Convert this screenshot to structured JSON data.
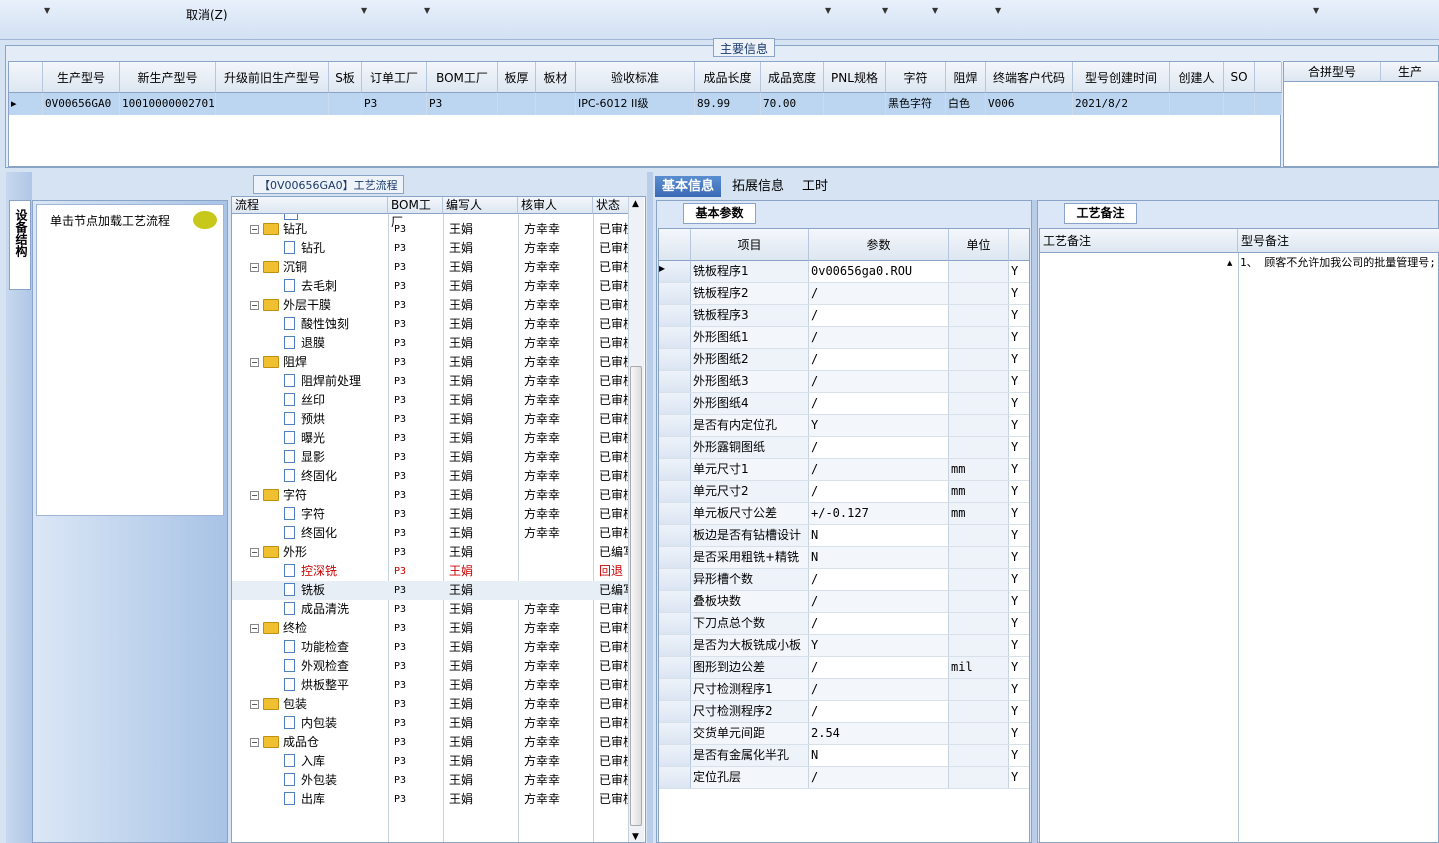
{
  "toolbar": {
    "cancel_label": "取消(Z)"
  },
  "main_info": {
    "title": "主要信息",
    "columns": [
      "生产型号",
      "新生产型号",
      "升级前旧生产型号",
      "S板",
      "订单工厂",
      "BOM工厂",
      "板厚",
      "板材",
      "验收标准",
      "成品长度",
      "成品宽度",
      "PNL规格",
      "字符",
      "阻焊",
      "终端客户代码",
      "型号创建时间",
      "创建人",
      "SO"
    ],
    "row": [
      "0V00656GA0",
      "10010000002701",
      "",
      "",
      "P3",
      "P3",
      "",
      "",
      "IPC-6012 II级",
      "89.99",
      "70.00",
      "",
      "黑色字符",
      "白色",
      "V006",
      "2021/8/2",
      "",
      ""
    ],
    "merge_columns": [
      "合拼型号",
      "生产"
    ]
  },
  "left_tab": {
    "label": "设备结构",
    "hint": "单击节点加载工艺流程"
  },
  "flow": {
    "title": "【0V00656GA0】工艺流程",
    "columns": [
      "流程",
      "BOM工厂",
      "编写人",
      "核审人",
      "状态"
    ],
    "rows": [
      {
        "level": 0,
        "name": "钻孔",
        "factory": "P3",
        "writer": "王娟",
        "reviewer": "方幸幸",
        "status": "已审核",
        "red": false
      },
      {
        "level": 1,
        "name": "钻孔",
        "factory": "P3",
        "writer": "王娟",
        "reviewer": "方幸幸",
        "status": "已审核",
        "red": false
      },
      {
        "level": 0,
        "name": "沉铜",
        "factory": "P3",
        "writer": "王娟",
        "reviewer": "方幸幸",
        "status": "已审核",
        "red": false
      },
      {
        "level": 1,
        "name": "去毛刺",
        "factory": "P3",
        "writer": "王娟",
        "reviewer": "方幸幸",
        "status": "已审核",
        "red": false
      },
      {
        "level": 0,
        "name": "外层干膜",
        "factory": "P3",
        "writer": "王娟",
        "reviewer": "方幸幸",
        "status": "已审核",
        "red": false
      },
      {
        "level": 1,
        "name": "酸性蚀刻",
        "factory": "P3",
        "writer": "王娟",
        "reviewer": "方幸幸",
        "status": "已审核",
        "red": false
      },
      {
        "level": 1,
        "name": "退膜",
        "factory": "P3",
        "writer": "王娟",
        "reviewer": "方幸幸",
        "status": "已审核",
        "red": false
      },
      {
        "level": 0,
        "name": "阻焊",
        "factory": "P3",
        "writer": "王娟",
        "reviewer": "方幸幸",
        "status": "已审核",
        "red": false
      },
      {
        "level": 1,
        "name": "阻焊前处理",
        "factory": "P3",
        "writer": "王娟",
        "reviewer": "方幸幸",
        "status": "已审核",
        "red": false
      },
      {
        "level": 1,
        "name": "丝印",
        "factory": "P3",
        "writer": "王娟",
        "reviewer": "方幸幸",
        "status": "已审核",
        "red": false
      },
      {
        "level": 1,
        "name": "预烘",
        "factory": "P3",
        "writer": "王娟",
        "reviewer": "方幸幸",
        "status": "已审核",
        "red": false
      },
      {
        "level": 1,
        "name": "曝光",
        "factory": "P3",
        "writer": "王娟",
        "reviewer": "方幸幸",
        "status": "已审核",
        "red": false
      },
      {
        "level": 1,
        "name": "显影",
        "factory": "P3",
        "writer": "王娟",
        "reviewer": "方幸幸",
        "status": "已审核",
        "red": false
      },
      {
        "level": 1,
        "name": "终固化",
        "factory": "P3",
        "writer": "王娟",
        "reviewer": "方幸幸",
        "status": "已审核",
        "red": false
      },
      {
        "level": 0,
        "name": "字符",
        "factory": "P3",
        "writer": "王娟",
        "reviewer": "方幸幸",
        "status": "已审核",
        "red": false
      },
      {
        "level": 1,
        "name": "字符",
        "factory": "P3",
        "writer": "王娟",
        "reviewer": "方幸幸",
        "status": "已审核",
        "red": false
      },
      {
        "level": 1,
        "name": "终固化",
        "factory": "P3",
        "writer": "王娟",
        "reviewer": "方幸幸",
        "status": "已审核",
        "red": false
      },
      {
        "level": 0,
        "name": "外形",
        "factory": "P3",
        "writer": "王娟",
        "reviewer": "",
        "status": "已编写",
        "red": false
      },
      {
        "level": 1,
        "name": "控深铣",
        "factory": "P3",
        "writer": "王娟",
        "reviewer": "",
        "status": "回退",
        "red": true
      },
      {
        "level": 1,
        "name": "铣板",
        "factory": "P3",
        "writer": "王娟",
        "reviewer": "",
        "status": "已编写",
        "red": false,
        "selected": true
      },
      {
        "level": 1,
        "name": "成品清洗",
        "factory": "P3",
        "writer": "王娟",
        "reviewer": "方幸幸",
        "status": "已审核",
        "red": false
      },
      {
        "level": 0,
        "name": "终检",
        "factory": "P3",
        "writer": "王娟",
        "reviewer": "方幸幸",
        "status": "已审核",
        "red": false
      },
      {
        "level": 1,
        "name": "功能检查",
        "factory": "P3",
        "writer": "王娟",
        "reviewer": "方幸幸",
        "status": "已审核",
        "red": false
      },
      {
        "level": 1,
        "name": "外观检查",
        "factory": "P3",
        "writer": "王娟",
        "reviewer": "方幸幸",
        "status": "已审核",
        "red": false
      },
      {
        "level": 1,
        "name": "烘板整平",
        "factory": "P3",
        "writer": "王娟",
        "reviewer": "方幸幸",
        "status": "已审核",
        "red": false
      },
      {
        "level": 0,
        "name": "包装",
        "factory": "P3",
        "writer": "王娟",
        "reviewer": "方幸幸",
        "status": "已审核",
        "red": false
      },
      {
        "level": 1,
        "name": "内包装",
        "factory": "P3",
        "writer": "王娟",
        "reviewer": "方幸幸",
        "status": "已审核",
        "red": false
      },
      {
        "level": 0,
        "name": "成品仓",
        "factory": "P3",
        "writer": "王娟",
        "reviewer": "方幸幸",
        "status": "已审核",
        "red": false
      },
      {
        "level": 1,
        "name": "入库",
        "factory": "P3",
        "writer": "王娟",
        "reviewer": "方幸幸",
        "status": "已审核",
        "red": false
      },
      {
        "level": 1,
        "name": "外包装",
        "factory": "P3",
        "writer": "王娟",
        "reviewer": "方幸幸",
        "status": "已审核",
        "red": false
      },
      {
        "level": 1,
        "name": "出库",
        "factory": "P3",
        "writer": "王娟",
        "reviewer": "方幸幸",
        "status": "已审核",
        "red": false
      }
    ]
  },
  "tabs": [
    "基本信息",
    "拓展信息",
    "工时"
  ],
  "basic": {
    "title": "基本参数",
    "columns": [
      "项目",
      "参数",
      "单位"
    ],
    "rows": [
      {
        "item": "铣板程序1",
        "param": "0v00656ga0.ROU",
        "unit": "",
        "flag": "Y"
      },
      {
        "item": "铣板程序2",
        "param": "/",
        "unit": "",
        "flag": "Y"
      },
      {
        "item": "铣板程序3",
        "param": "/",
        "unit": "",
        "flag": "Y"
      },
      {
        "item": "外形图纸1",
        "param": "/",
        "unit": "",
        "flag": "Y"
      },
      {
        "item": "外形图纸2",
        "param": "/",
        "unit": "",
        "flag": "Y"
      },
      {
        "item": "外形图纸3",
        "param": "/",
        "unit": "",
        "flag": "Y"
      },
      {
        "item": "外形图纸4",
        "param": "/",
        "unit": "",
        "flag": "Y"
      },
      {
        "item": "是否有内定位孔",
        "param": "Y",
        "unit": "",
        "flag": "Y"
      },
      {
        "item": "外形露铜图纸",
        "param": "/",
        "unit": "",
        "flag": "Y"
      },
      {
        "item": "单元尺寸1",
        "param": "/",
        "unit": "mm",
        "flag": "Y"
      },
      {
        "item": "单元尺寸2",
        "param": "/",
        "unit": "mm",
        "flag": "Y"
      },
      {
        "item": "单元板尺寸公差",
        "param": "+/-0.127",
        "unit": "mm",
        "flag": "Y"
      },
      {
        "item": "板边是否有钻槽设计",
        "param": "N",
        "unit": "",
        "flag": "Y"
      },
      {
        "item": "是否采用粗铣+精铣",
        "param": "N",
        "unit": "",
        "flag": "Y"
      },
      {
        "item": "异形槽个数",
        "param": "/",
        "unit": "",
        "flag": "Y"
      },
      {
        "item": "叠板块数",
        "param": "/",
        "unit": "",
        "flag": "Y"
      },
      {
        "item": "下刀点总个数",
        "param": "/",
        "unit": "",
        "flag": "Y"
      },
      {
        "item": "是否为大板铣成小板",
        "param": "Y",
        "unit": "",
        "flag": "Y"
      },
      {
        "item": "图形到边公差",
        "param": "/",
        "unit": "mil",
        "flag": "Y"
      },
      {
        "item": "尺寸检测程序1",
        "param": "/",
        "unit": "",
        "flag": "Y"
      },
      {
        "item": "尺寸检测程序2",
        "param": "/",
        "unit": "",
        "flag": "Y"
      },
      {
        "item": "交货单元间距",
        "param": "2.54",
        "unit": "",
        "flag": "Y"
      },
      {
        "item": "是否有金属化半孔",
        "param": "N",
        "unit": "",
        "flag": "Y"
      },
      {
        "item": "定位孔层",
        "param": "/",
        "unit": "",
        "flag": "Y"
      }
    ]
  },
  "remarks": {
    "title": "工艺备注",
    "columns": [
      "工艺备注",
      "型号备注"
    ],
    "model_note": "1、   顾客不允许加我公司的批量管理号;"
  },
  "colors": {
    "selection": "#bcd6f2",
    "active_tab": "#3a6ab5",
    "returned": "#cc0000"
  }
}
